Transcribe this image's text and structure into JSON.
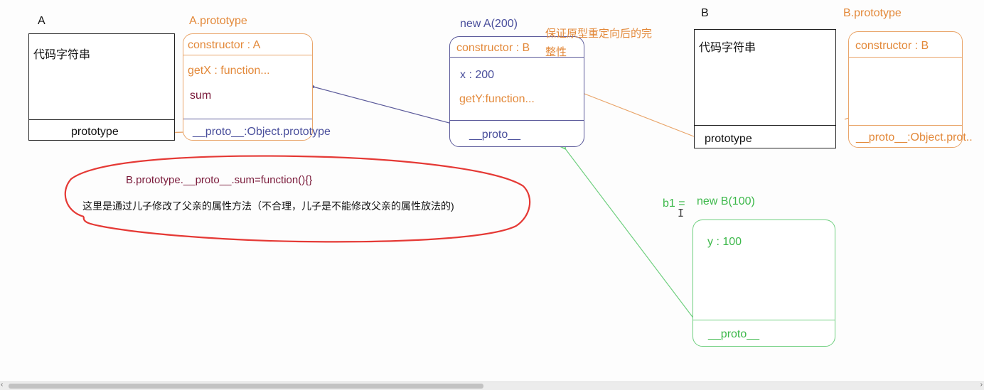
{
  "classA": {
    "title": "A",
    "body": "代码字符串",
    "prototype_label": "prototype"
  },
  "aPrototype": {
    "title": "A.prototype",
    "constructor": "constructor : A",
    "getX": "getX : function...",
    "sum": "sum",
    "proto": "__proto__:Object.prototype"
  },
  "instanceA": {
    "title": "new A(200)",
    "constructor": "constructor : B",
    "note_line1": "保证原型重定向后的完",
    "note_line2": "整性",
    "x": "x : 200",
    "getY": "getY:function...",
    "proto": "__proto__"
  },
  "classB": {
    "title": "B",
    "body": "代码字符串",
    "prototype_label": "prototype"
  },
  "bPrototype": {
    "title": "B.prototype",
    "constructor": "constructor : B",
    "proto": "__proto__:Object.prot.."
  },
  "annotation": {
    "code": "B.prototype.__proto__.sum=function(){}",
    "text": "这里是通过儿子修改了父亲的属性方法（不合理，儿子是不能修改父亲的属性放法的)"
  },
  "instanceB": {
    "var": "b1 =",
    "title": "new B(100)",
    "y": "y : 100",
    "proto": "__proto__"
  },
  "colors": {
    "black": "#222222",
    "orange": "#e9a56a",
    "blue": "#5b5a9a",
    "green": "#6fcf7f",
    "red": "#e53935",
    "maroon": "#7a1a3a"
  }
}
